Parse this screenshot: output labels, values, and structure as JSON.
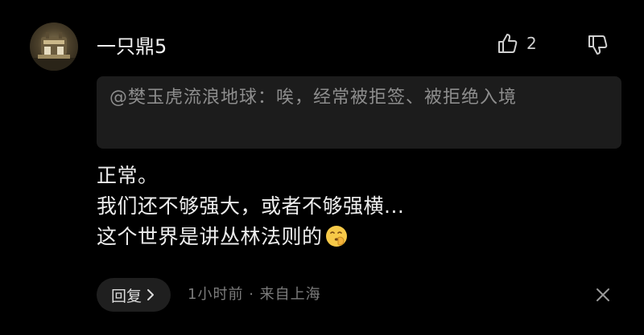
{
  "comment": {
    "username": "一只鼎5",
    "like_count": "2",
    "quote_text": "@樊玉虎流浪地球：唉，经常被拒签、被拒绝入境",
    "body_lines": [
      "正常。",
      "我们还不够强大，或者不够强横...",
      "这个世界是讲丛林法则的"
    ],
    "reply_label": "回复",
    "time": "1小时前",
    "location": "来自上海"
  },
  "icons": {
    "avatar": "avatar-image",
    "like": "thumbs-up-icon",
    "dislike": "thumbs-down-icon",
    "reply_chevron": "chevron-right-icon",
    "close": "close-icon",
    "emoji": "shushing-face-emoji"
  },
  "colors": {
    "background": "#000000",
    "quote_background": "#1c1c1c",
    "primary_text": "#ededed",
    "secondary_text": "#8d8d8d",
    "meta_text": "#7c7c7c",
    "emoji_yellow": "#f7c948"
  }
}
